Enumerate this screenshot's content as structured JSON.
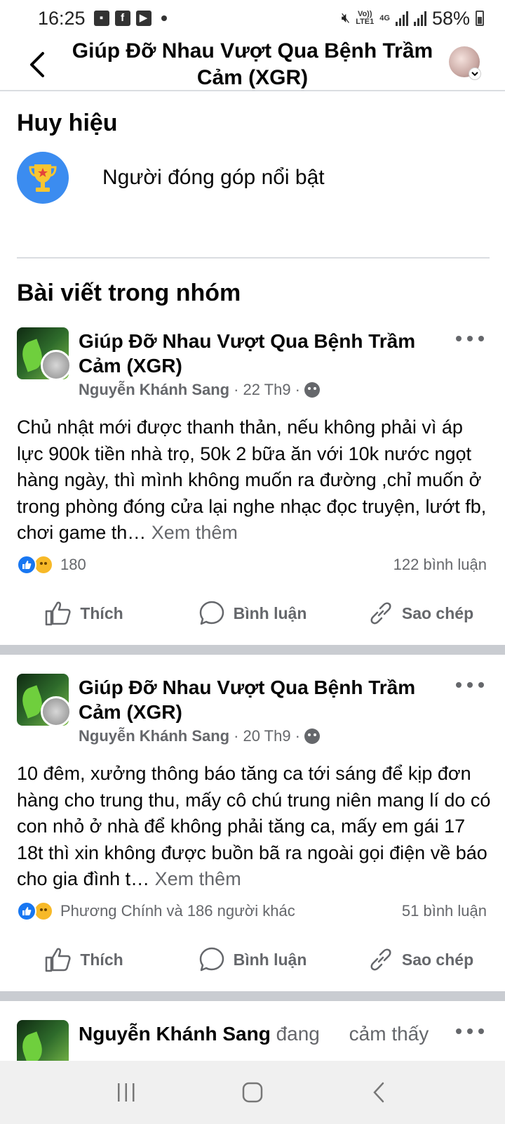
{
  "status_bar": {
    "time": "16:25",
    "battery": "58%",
    "network_top": "4G",
    "volte_line1": "Vo))",
    "volte_line2": "LTE1"
  },
  "header": {
    "title": "Giúp Đỡ Nhau Vượt Qua Bệnh Trầm Cảm (XGR)"
  },
  "badges": {
    "title": "Huy hiệu",
    "items": [
      {
        "label": "Người đóng góp nổi bật",
        "icon": "trophy-icon"
      }
    ]
  },
  "posts_section": {
    "title": "Bài viết trong nhóm"
  },
  "posts": [
    {
      "group": "Giúp Đỡ Nhau Vượt Qua Bệnh Trầm Cảm (XGR)",
      "author": "Nguyễn Khánh Sang",
      "separator": "·",
      "date": "22 Th9",
      "text": "Chủ nhật mới được thanh thản, nếu không phải vì áp lực 900k tiền nhà trọ, 50k 2 bữa ăn với 10k nước ngọt hàng ngày, thì mình không muốn ra đường ,chỉ muốn ở trong phòng đóng cửa lại nghe nhạc đọc truyện, lướt fb, chơi game th…",
      "see_more": "Xem thêm",
      "reactions_text": "180",
      "comments": "122 bình luận"
    },
    {
      "group": "Giúp Đỡ Nhau Vượt Qua Bệnh Trầm Cảm (XGR)",
      "author": "Nguyễn Khánh Sang",
      "separator": "·",
      "date": "20 Th9",
      "text": "10 đêm, xưởng thông báo tăng ca tới sáng để kịp đơn hàng cho trung thu, mấy cô chú trung niên mang lí do có con nhỏ ở nhà để không phải tăng ca, mấy em gái 17 18t thì xin không được buồn bã ra ngoài gọi điện về báo cho gia đình t…",
      "see_more": "Xem thêm",
      "reactions_text": "Phương Chính và 186 người khác",
      "comments": "51 bình luận"
    }
  ],
  "actions": {
    "like": "Thích",
    "comment": "Bình luận",
    "copy": "Sao chép"
  },
  "partial_post": {
    "author": "Nguyễn Khánh Sang",
    "status": "đang",
    "feeling": "cảm thấy"
  },
  "colors": {
    "primary": "#1877f2",
    "secondary_text": "#65676b",
    "separator": "#c9ccd1"
  }
}
